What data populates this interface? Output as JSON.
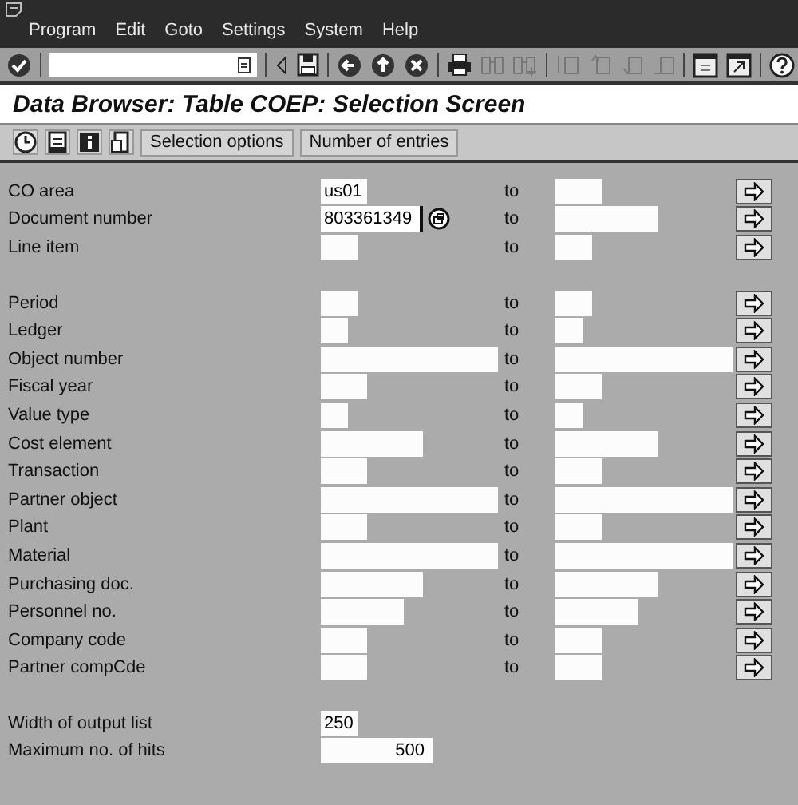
{
  "menu": [
    {
      "label": "Program"
    },
    {
      "label": "Edit"
    },
    {
      "label": "Goto"
    },
    {
      "label": "Settings"
    },
    {
      "label": "System"
    },
    {
      "label": "Help"
    }
  ],
  "title": "Data Browser: Table COEP: Selection Screen",
  "app_toolbar": {
    "buttons": [
      "Selection options",
      "Number of entries"
    ]
  },
  "groups": [
    {
      "rows": [
        {
          "label": "CO area",
          "value": "us01",
          "to": "to",
          "focused": false
        },
        {
          "label": "Document number",
          "value": "803361349",
          "to": "to",
          "focused": true
        },
        {
          "label": "Line item",
          "to": "to",
          "focused": false
        }
      ]
    },
    {
      "rows": [
        {
          "label": "Period",
          "to": "to",
          "focused": false
        },
        {
          "label": "Ledger",
          "to": "to",
          "focused": false
        },
        {
          "label": "Object number",
          "to": "to",
          "focused": false
        },
        {
          "label": "Fiscal year",
          "to": "to",
          "focused": false
        },
        {
          "label": "Value type",
          "to": "to",
          "focused": false
        },
        {
          "label": "Cost element",
          "to": "to",
          "focused": false
        },
        {
          "label": "Transaction",
          "to": "to",
          "focused": false
        },
        {
          "label": "Partner object",
          "to": "to",
          "focused": false
        },
        {
          "label": "Plant",
          "to": "to",
          "focused": false
        },
        {
          "label": "Material",
          "to": "to",
          "focused": false
        },
        {
          "label": "Purchasing doc.",
          "to": "to",
          "focused": false
        },
        {
          "label": "Personnel no.",
          "to": "to",
          "focused": false
        },
        {
          "label": "Company code",
          "to": "to",
          "focused": false
        },
        {
          "label": "Partner compCde",
          "to": "to",
          "focused": false
        }
      ]
    }
  ],
  "settings": [
    {
      "label": "Width of output list",
      "value": "250"
    },
    {
      "label": "Maximum no. of hits",
      "value": "500"
    }
  ]
}
